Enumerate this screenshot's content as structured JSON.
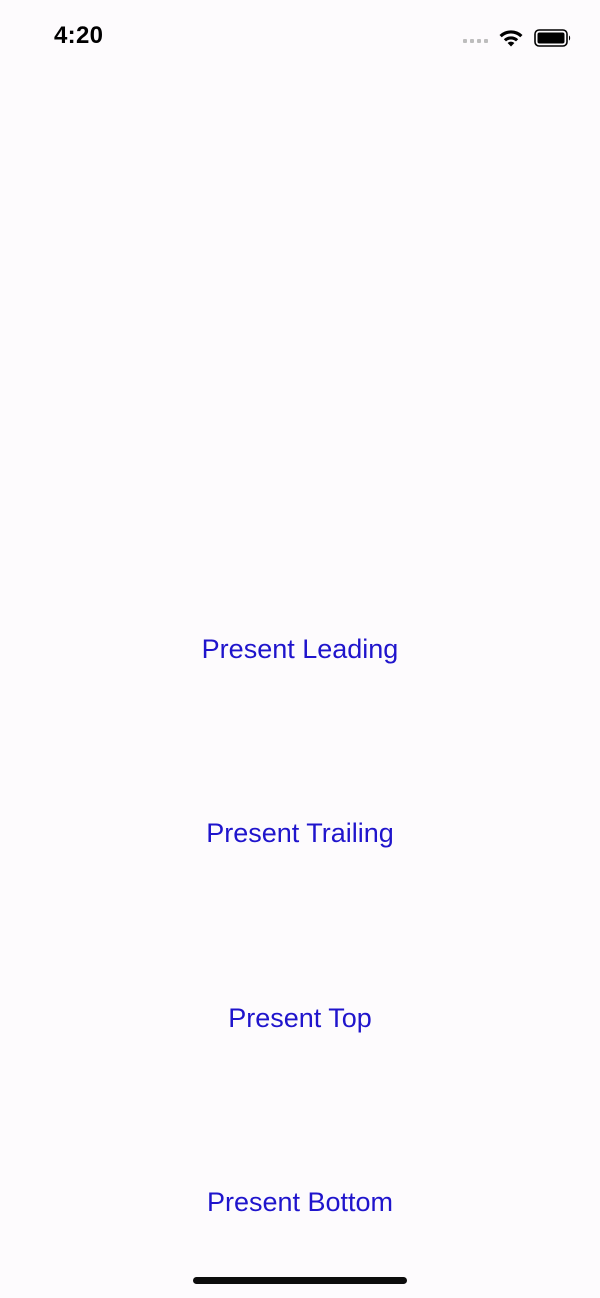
{
  "status_bar": {
    "time": "4:20",
    "icons": [
      "cellular-signal-icon",
      "wifi-icon",
      "battery-icon"
    ]
  },
  "buttons": {
    "present_leading": "Present Leading",
    "present_trailing": "Present Trailing",
    "present_top": "Present Top",
    "present_bottom": "Present Bottom"
  },
  "colors": {
    "background": "#fdfbfd",
    "button_text": "#1f14cc",
    "status_text": "#000000"
  }
}
